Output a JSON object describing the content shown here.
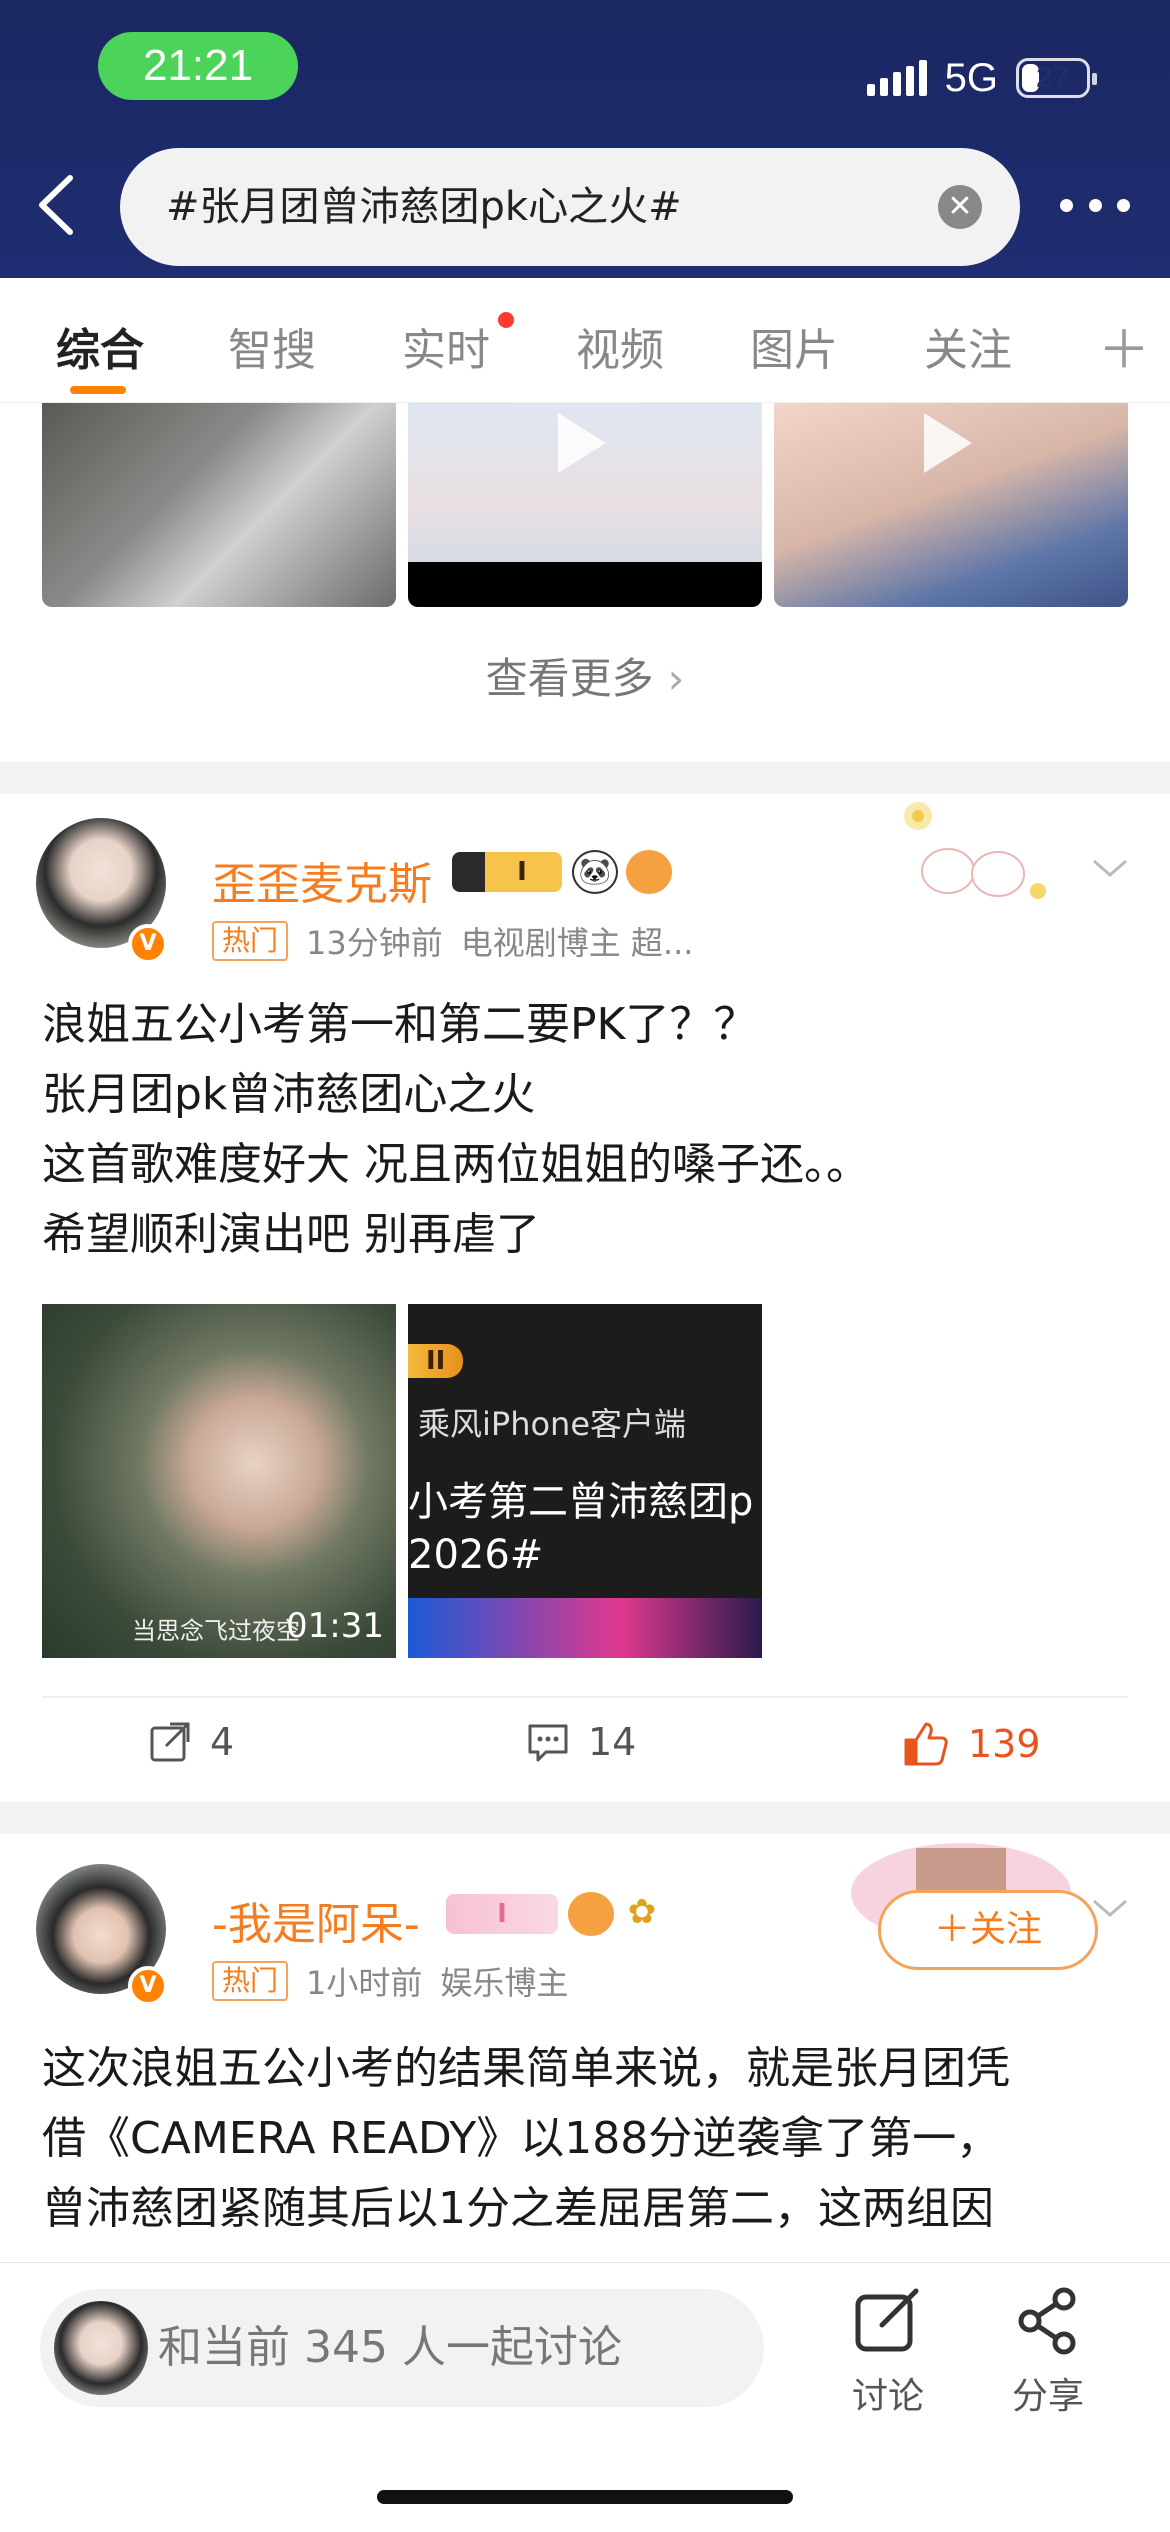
{
  "status_bar": {
    "time": "21:21",
    "network": "5G",
    "battery": "27",
    "battery_level": 0.27
  },
  "search": {
    "query": "#张月团曾沛慈团pk心之火#"
  },
  "tabs": [
    {
      "label": "综合",
      "active": true
    },
    {
      "label": "智搜"
    },
    {
      "label": "实时",
      "has_dot": true
    },
    {
      "label": "视频"
    },
    {
      "label": "图片"
    },
    {
      "label": "关注"
    }
  ],
  "tab_add_icon": "plus-icon",
  "see_more": {
    "label": "查看更多"
  },
  "posts": [
    {
      "username": "歪歪麦克斯",
      "level_badge": "I",
      "hot_tag": "热门",
      "time": "13分钟前",
      "source": "电视剧博主 超...",
      "text_lines": [
        "浪姐五公小考第一和第二要PK了？？",
        "张月团pk曾沛慈团心之火",
        "这首歌难度好大 况且两位姐姐的嗓子还。。",
        "希望顺利演出吧 别再虐了"
      ],
      "media": [
        {
          "duration": "01:31",
          "caption": "当思念飞过夜空"
        },
        {
          "badge": "II",
          "line1": "乘风iPhone客户端",
          "line2": "小考第二曾沛慈团p",
          "line3": "2026#"
        }
      ],
      "actions": {
        "repost": "4",
        "comment": "14",
        "like": "139"
      }
    },
    {
      "username": "-我是阿呆-",
      "level_badge": "I",
      "hot_tag": "热门",
      "time": "1小时前",
      "source": "娱乐博主",
      "follow_label": "＋关注",
      "text_lines": [
        "这次浪姐五公小考的结果简单来说，就是张月团凭",
        "借《CAMERA READY》以188分逆袭拿了第一，",
        "曾沛慈团紧随其后以1分之差屈居第二，这两组因"
      ]
    }
  ],
  "bottom_bar": {
    "discuss_placeholder": "和当前 345 人一起讨论",
    "discuss_label": "讨论",
    "share_label": "分享"
  },
  "colors": {
    "header_bg": "#1f2d72",
    "accent": "#ff8200",
    "username": "#f57d1f",
    "like": "#e8541e"
  }
}
